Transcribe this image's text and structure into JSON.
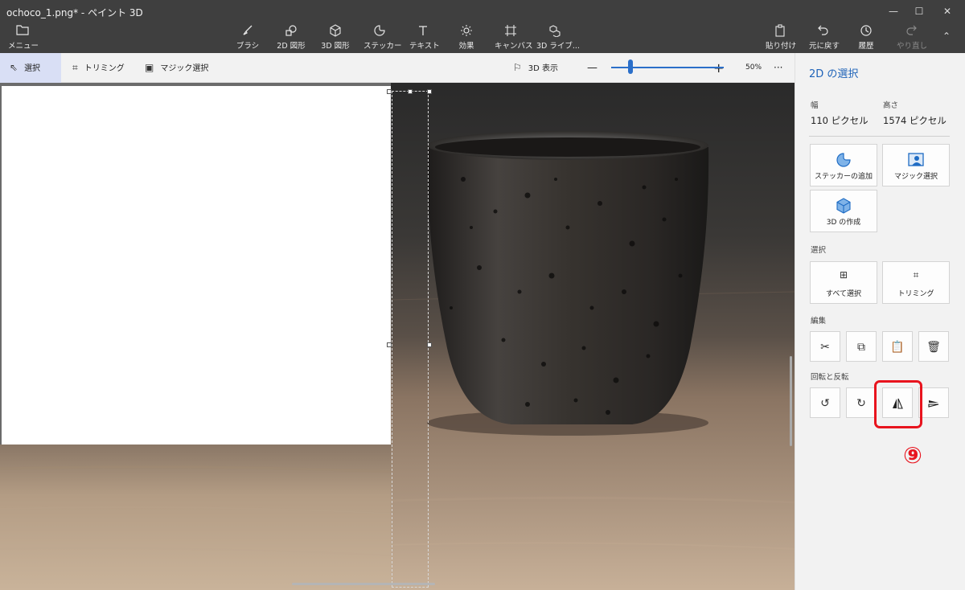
{
  "window": {
    "title": "ochoco_1.png* - ペイント 3D",
    "minimize": "—",
    "maximize": "☐",
    "close": "✕"
  },
  "toolbar": {
    "menu": {
      "label": "メニュー",
      "icon": "folder-icon"
    },
    "tools": [
      {
        "label": "ブラシ",
        "icon": "brush-icon"
      },
      {
        "label": "2D 図形",
        "icon": "shapes-2d-icon"
      },
      {
        "label": "3D 図形",
        "icon": "cube-icon"
      },
      {
        "label": "ステッカー",
        "icon": "sticker-icon"
      },
      {
        "label": "テキスト",
        "icon": "text-icon"
      },
      {
        "label": "効果",
        "icon": "sun-icon"
      },
      {
        "label": "キャンバス",
        "icon": "canvas-icon"
      },
      {
        "label": "3D ライブ...",
        "icon": "library-3d-icon"
      }
    ],
    "right": [
      {
        "label": "貼り付け",
        "icon": "paste-icon"
      },
      {
        "label": "元に戻す",
        "icon": "undo-icon"
      },
      {
        "label": "履歴",
        "icon": "history-icon"
      },
      {
        "label": "やり直し",
        "icon": "redo-icon"
      }
    ]
  },
  "subbar": {
    "select": "選択",
    "crop": "トリミング",
    "magic_select": "マジック選択",
    "view3d": "3D 表示",
    "zoom_minus": "—",
    "zoom_plus": "+",
    "zoom": "50%",
    "more": "···",
    "zoom_level": 0.17
  },
  "panel": {
    "title": "2D の選択",
    "width_label": "幅",
    "width_value": "110 ピクセル",
    "height_label": "高さ",
    "height_value": "1574 ピクセル",
    "add_sticker": "ステッカーの追加",
    "magic_select": "マジック選択",
    "make_3d": "3D の作成",
    "select_section": "選択",
    "select_all": "すべて選択",
    "crop": "トリミング",
    "edit_section": "編集",
    "rotate_section": "回転と反転"
  },
  "annotation": {
    "number": "⑨",
    "color": "#e8141e"
  },
  "colors": {
    "accent": "#1d62b8",
    "titlebar": "#3f3f3f"
  }
}
